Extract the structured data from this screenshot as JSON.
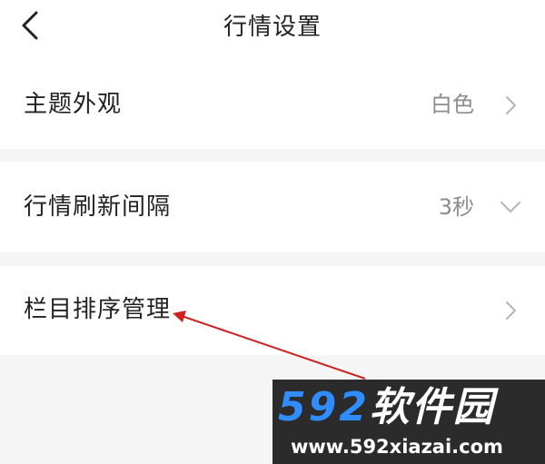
{
  "header": {
    "title": "行情设置",
    "back_icon": "chevron-left-icon"
  },
  "settings": [
    {
      "label": "主题外观",
      "value": "白色",
      "icon": "chevron-right-icon"
    },
    {
      "label": "行情刷新间隔",
      "value": "3秒",
      "icon": "chevron-down-icon"
    },
    {
      "label": "栏目排序管理",
      "value": "",
      "icon": "chevron-right-icon"
    }
  ],
  "watermark": {
    "brand_number": "592",
    "brand_name": "软件园",
    "url": "www.592xiazai.com"
  },
  "colors": {
    "page_background": "#f5f5f5",
    "row_background": "#ffffff",
    "text_primary": "#222222",
    "text_secondary": "#8c8c8c",
    "annotation_arrow": "#cc2222",
    "watermark_number": "#2f8dff"
  }
}
